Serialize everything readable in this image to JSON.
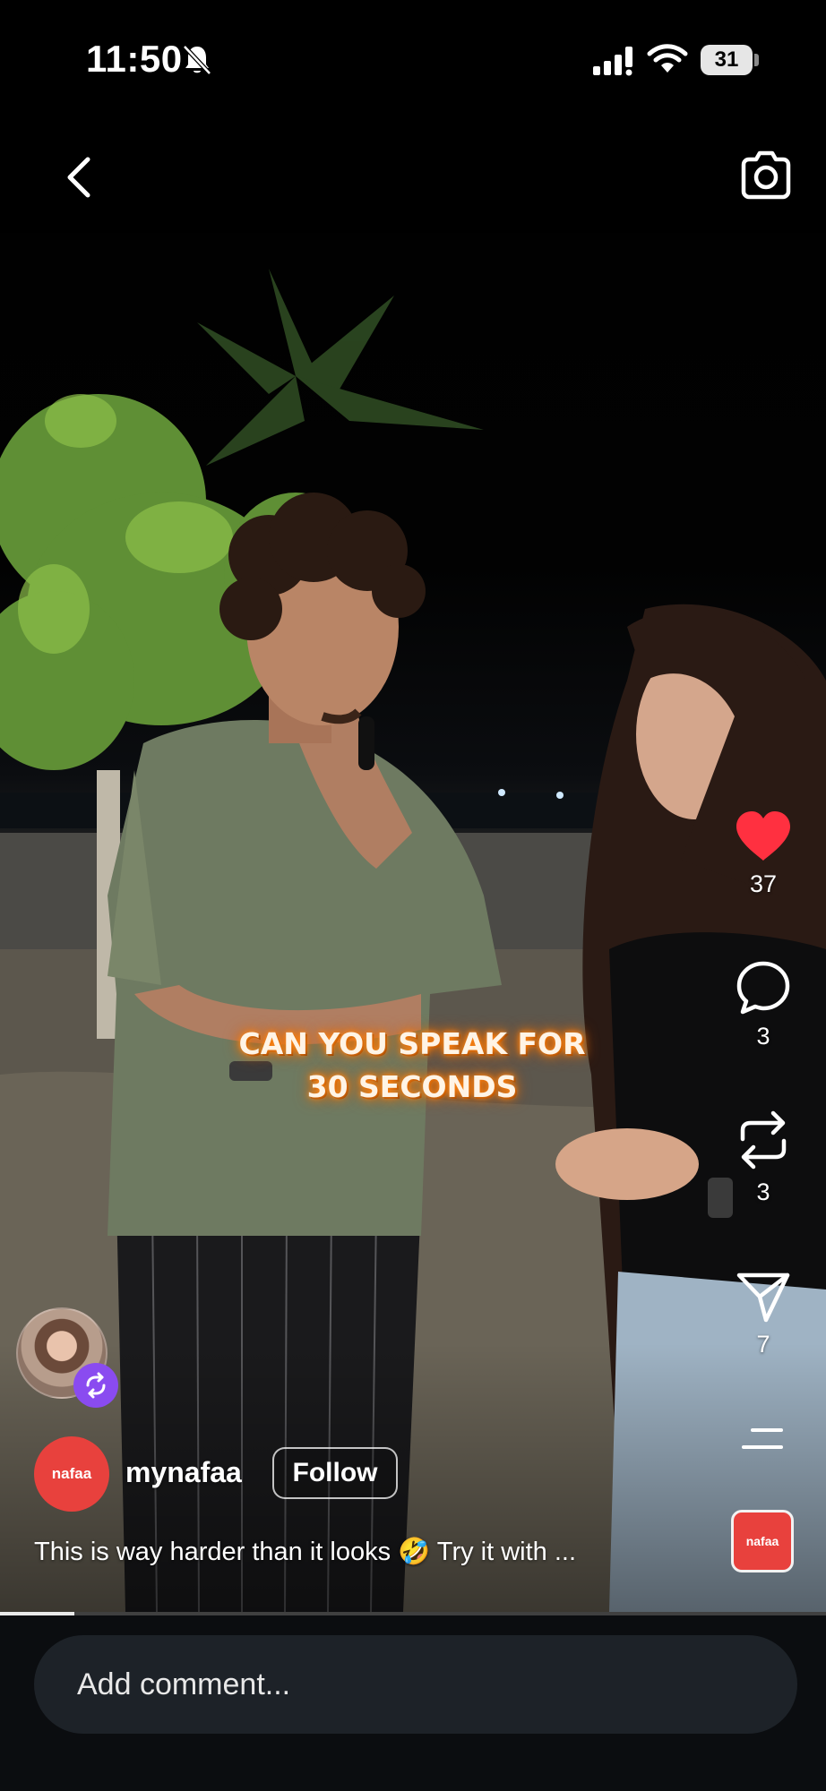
{
  "status_bar": {
    "time": "11:50",
    "battery": "31",
    "icons": [
      "bell-muted-icon",
      "cellular-signal-icon",
      "wifi-icon",
      "battery-icon"
    ]
  },
  "top_bar": {
    "back_icon": "chevron-left-icon",
    "camera_icon": "camera-icon"
  },
  "video": {
    "caption_line1": "CAN YOU SPEAK FOR",
    "caption_line2": "30 SECONDS"
  },
  "actions": {
    "like_count": "37",
    "comment_count": "3",
    "repost_count": "3",
    "share_count": "7",
    "like_color": "#ff3040"
  },
  "post": {
    "username": "mynafaa",
    "follow_label": "Follow",
    "avatar_text": "nafaa",
    "description": "This is way harder than it looks 🤣 Try it with ...",
    "audio_thumb_text": "nafaa"
  },
  "playback": {
    "progress": 0.09
  },
  "comment_bar": {
    "placeholder": "Add comment..."
  },
  "colors": {
    "accent": "#ff3040",
    "collab_badge": "#8a4bf0",
    "brand_red": "#e8413d"
  }
}
